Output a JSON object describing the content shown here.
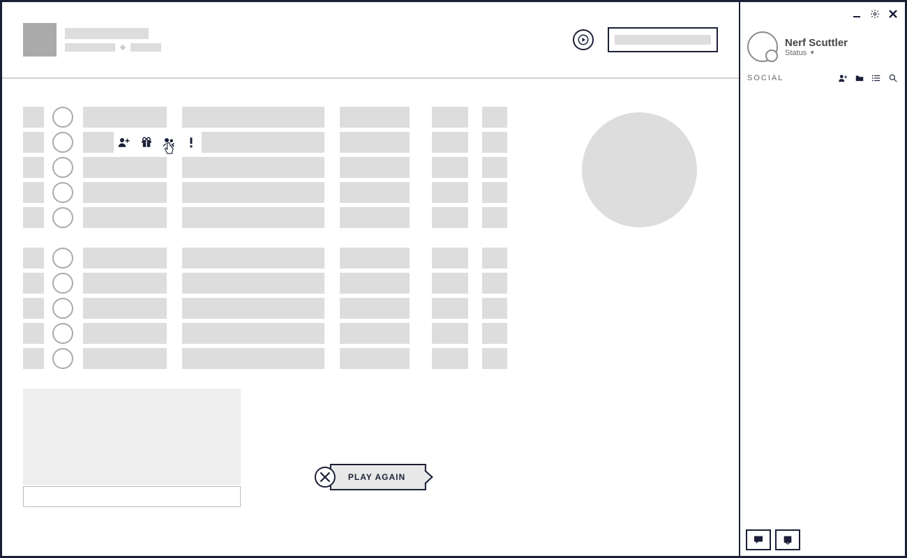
{
  "header": {
    "title_placeholder": "",
    "subtitle_a": "",
    "subtitle_b": ""
  },
  "play_again": {
    "label": "PLAY AGAIN"
  },
  "side": {
    "profile_name": "Nerf Scuttler",
    "status_label": "Status",
    "social_label": "SOCIAL"
  },
  "row_actions": {
    "add_friend": "add-friend",
    "gift": "gift",
    "invite": "invite-to-party",
    "report": "report"
  },
  "teams": [
    {
      "rows": [
        {
          "rank": "",
          "name": "",
          "c1": "",
          "c2": "",
          "c3": "",
          "c4": ""
        },
        {
          "rank": "",
          "name": "",
          "c1": "",
          "c2": "",
          "c3": "",
          "c4": "",
          "hover": true
        },
        {
          "rank": "",
          "name": "",
          "c1": "",
          "c2": "",
          "c3": "",
          "c4": ""
        },
        {
          "rank": "",
          "name": "",
          "c1": "",
          "c2": "",
          "c3": "",
          "c4": ""
        },
        {
          "rank": "",
          "name": "",
          "c1": "",
          "c2": "",
          "c3": "",
          "c4": ""
        }
      ]
    },
    {
      "rows": [
        {
          "rank": "",
          "name": "",
          "c1": "",
          "c2": "",
          "c3": "",
          "c4": ""
        },
        {
          "rank": "",
          "name": "",
          "c1": "",
          "c2": "",
          "c3": "",
          "c4": ""
        },
        {
          "rank": "",
          "name": "",
          "c1": "",
          "c2": "",
          "c3": "",
          "c4": ""
        },
        {
          "rank": "",
          "name": "",
          "c1": "",
          "c2": "",
          "c3": "",
          "c4": ""
        },
        {
          "rank": "",
          "name": "",
          "c1": "",
          "c2": "",
          "c3": "",
          "c4": ""
        }
      ]
    }
  ]
}
